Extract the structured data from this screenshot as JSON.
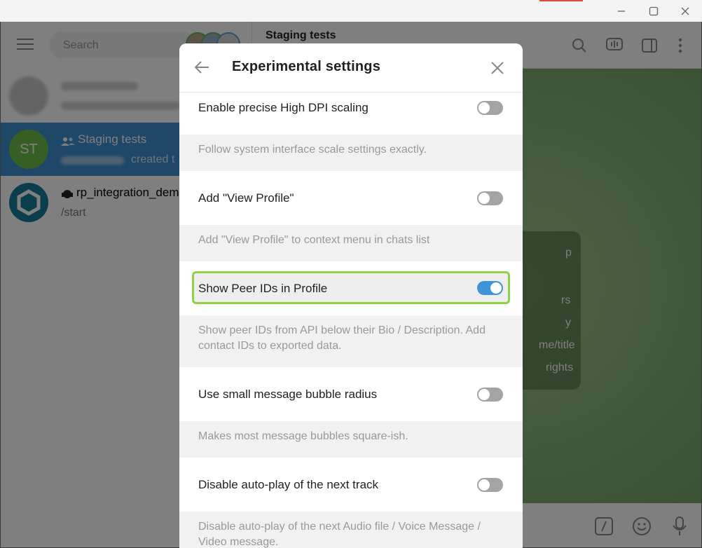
{
  "window": {
    "minimize_icon": "minimize-icon",
    "maximize_icon": "maximize-icon",
    "close_icon": "close-icon"
  },
  "sidebar": {
    "search_placeholder": "Search",
    "chats": [
      {
        "name": "",
        "preview": ""
      },
      {
        "name": "Staging tests",
        "preview": "created t",
        "initials": "ST",
        "avatar_color": "#6fbc4a"
      },
      {
        "name": "rp_integration_dem",
        "preview": "/start",
        "avatar_color": "#167c99"
      }
    ]
  },
  "chat": {
    "title": "Staging tests",
    "info_lines": [
      "p",
      "rs",
      "y",
      "me/title",
      "rights"
    ]
  },
  "dialog": {
    "title": "Experimental settings",
    "settings": [
      {
        "label": "Enable precise High DPI scaling",
        "enabled": false,
        "description": "Follow system interface scale settings exactly."
      },
      {
        "label": "Add \"View Profile\"",
        "enabled": false,
        "description": "Add \"View Profile\" to context menu in chats list"
      },
      {
        "label": "Show Peer IDs in Profile",
        "enabled": true,
        "description": "Show peer IDs from API below their Bio / Description. Add contact IDs to exported data."
      },
      {
        "label": "Use small message bubble radius",
        "enabled": false,
        "description": "Makes most message bubbles square-ish."
      },
      {
        "label": "Disable auto-play of the next track",
        "enabled": false,
        "description": "Disable auto-play of the next Audio file / Voice Message / Video message."
      }
    ]
  },
  "colors": {
    "accent": "#3d94d8",
    "highlight": "#8ed24a",
    "selected_chat": "#3d8fd1"
  }
}
